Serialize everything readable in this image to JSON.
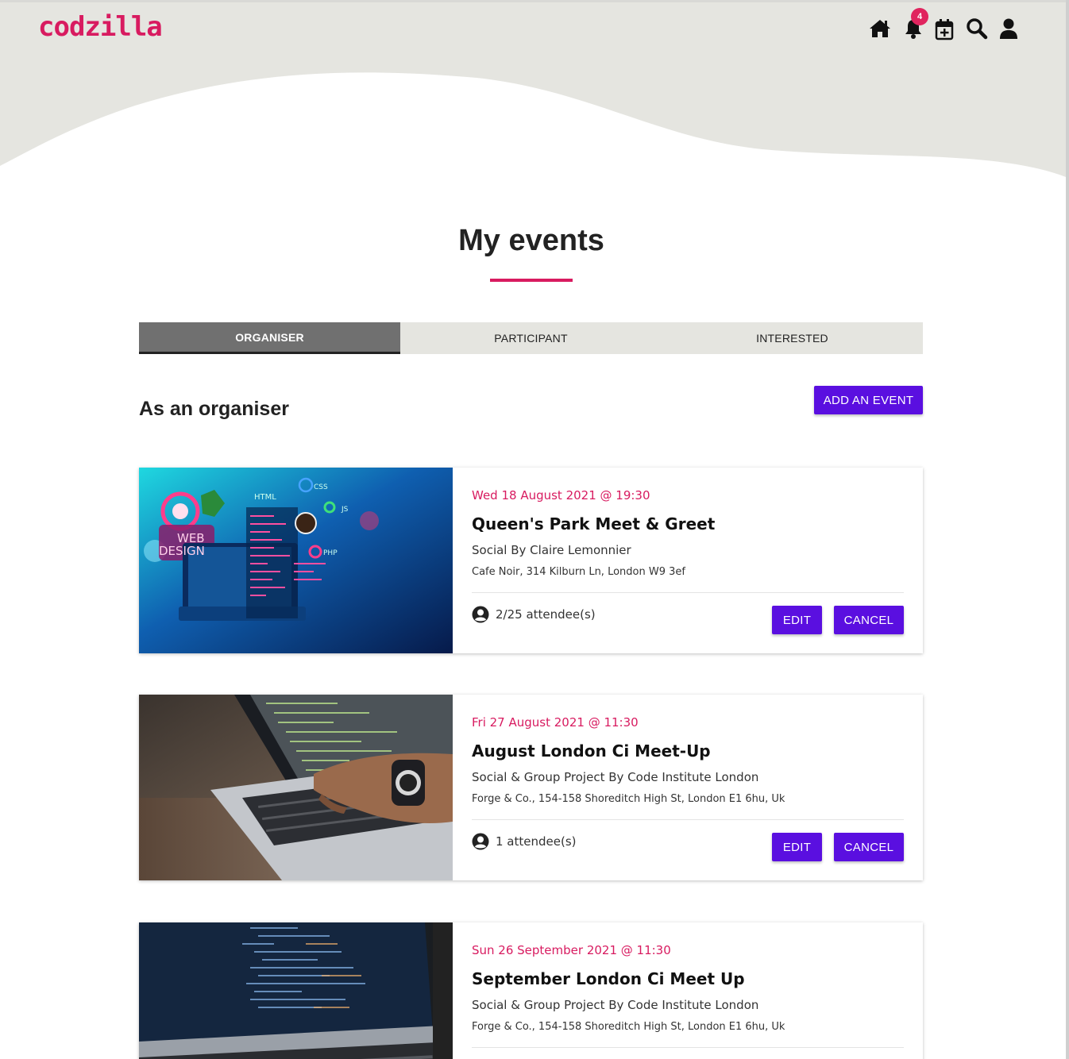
{
  "header": {
    "logo": "codzilla",
    "notification_count": "4",
    "icons": [
      "home-icon",
      "bell-icon",
      "calendar-plus-icon",
      "search-icon",
      "user-icon"
    ]
  },
  "main": {
    "title": "My events",
    "tabs": [
      {
        "label": "ORGANISER",
        "active": true
      },
      {
        "label": "PARTICIPANT",
        "active": false
      },
      {
        "label": "INTERESTED",
        "active": false
      }
    ],
    "section_heading": "As an organiser",
    "add_button": "ADD AN EVENT",
    "events": [
      {
        "date": "Wed 18 August 2021 @ 19:30",
        "title": "Queen's Park Meet & Greet",
        "category": "Social By Claire Lemonnier",
        "location": "Cafe Noir, 314 Kilburn Ln, London W9 3ef",
        "attendees": "2/25 attendee(s)",
        "edit_label": "EDIT",
        "cancel_label": "CANCEL",
        "image_labels": [
          "HTML",
          "CSS",
          "JS",
          "PHP",
          "WEB",
          "DESIGN"
        ]
      },
      {
        "date": "Fri 27 August 2021 @ 11:30",
        "title": "August London Ci Meet-Up",
        "category": "Social & Group Project By Code Institute London",
        "location": "Forge & Co., 154-158 Shoreditch High St, London E1 6hu, Uk",
        "attendees": "1 attendee(s)",
        "edit_label": "EDIT",
        "cancel_label": "CANCEL"
      },
      {
        "date": "Sun 26 September 2021 @ 11:30",
        "title": "September London Ci Meet Up",
        "category": "Social & Group Project By Code Institute London",
        "location": "Forge & Co., 154-158 Shoreditch High St, London E1 6hu, Uk"
      }
    ]
  },
  "colors": {
    "brand": "#d81b60",
    "button": "#5a0fe0",
    "hero_bg": "#e5e5e0",
    "tab_active": "#707070"
  }
}
